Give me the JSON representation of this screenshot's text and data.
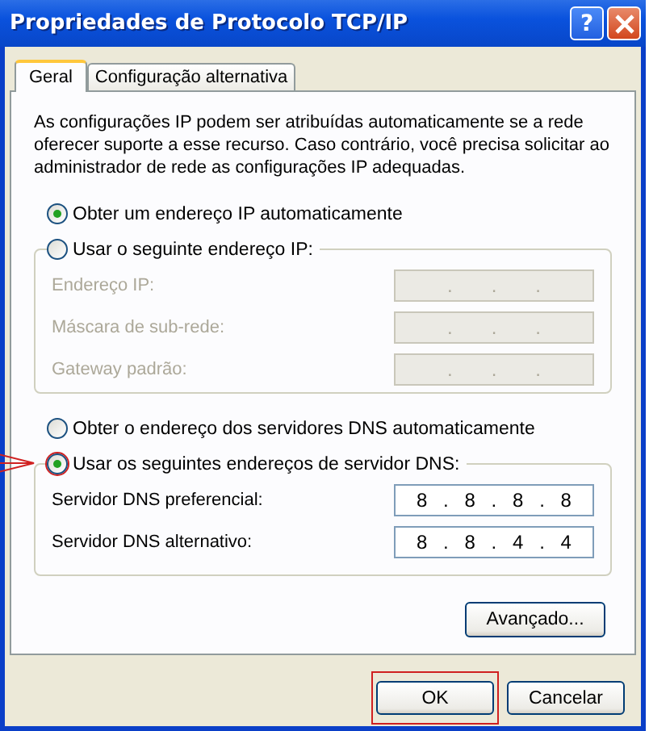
{
  "window": {
    "title": "Propriedades de Protocolo TCP/IP",
    "help_button": "?"
  },
  "tabs": [
    {
      "label": "Geral",
      "selected": true
    },
    {
      "label": "Configuração alternativa",
      "selected": false
    }
  ],
  "description": "As configurações IP podem ser atribuídas automaticamente se a rede oferecer suporte a esse recurso. Caso contrário, você precisa solicitar ao administrador de rede as configurações IP adequadas.",
  "ip_options": [
    {
      "label": "Obter um endereço IP automaticamente",
      "selected": true,
      "annotated": false
    },
    {
      "label": "Usar o seguinte endereço IP:",
      "selected": false,
      "annotated": false
    }
  ],
  "ip_fields": [
    {
      "label": "Endereço IP:",
      "disabled": true,
      "parts": [
        ".",
        ".",
        "."
      ]
    },
    {
      "label": "Máscara de sub-rede:",
      "disabled": true,
      "parts": [
        ".",
        ".",
        "."
      ]
    },
    {
      "label": "Gateway padrão:",
      "disabled": true,
      "parts": [
        ".",
        ".",
        "."
      ]
    }
  ],
  "dns_options": [
    {
      "label": "Obter o endereço dos servidores DNS automaticamente",
      "selected": false,
      "annotated": false
    },
    {
      "label": "Usar os seguintes endereços de servidor DNS:",
      "selected": true,
      "annotated": true
    }
  ],
  "dns_fields": [
    {
      "label": "Servidor DNS preferencial:",
      "disabled": false,
      "parts": [
        "8",
        ".",
        "8",
        ".",
        "8",
        ".",
        "8"
      ]
    },
    {
      "label": "Servidor DNS alternativo:",
      "disabled": false,
      "parts": [
        "8",
        ".",
        "8",
        ".",
        "4",
        ".",
        "4"
      ]
    }
  ],
  "advanced_button": "Avançado...",
  "buttons": [
    {
      "label": "OK",
      "highlighted": true
    },
    {
      "label": "Cancelar",
      "highlighted": false
    }
  ]
}
